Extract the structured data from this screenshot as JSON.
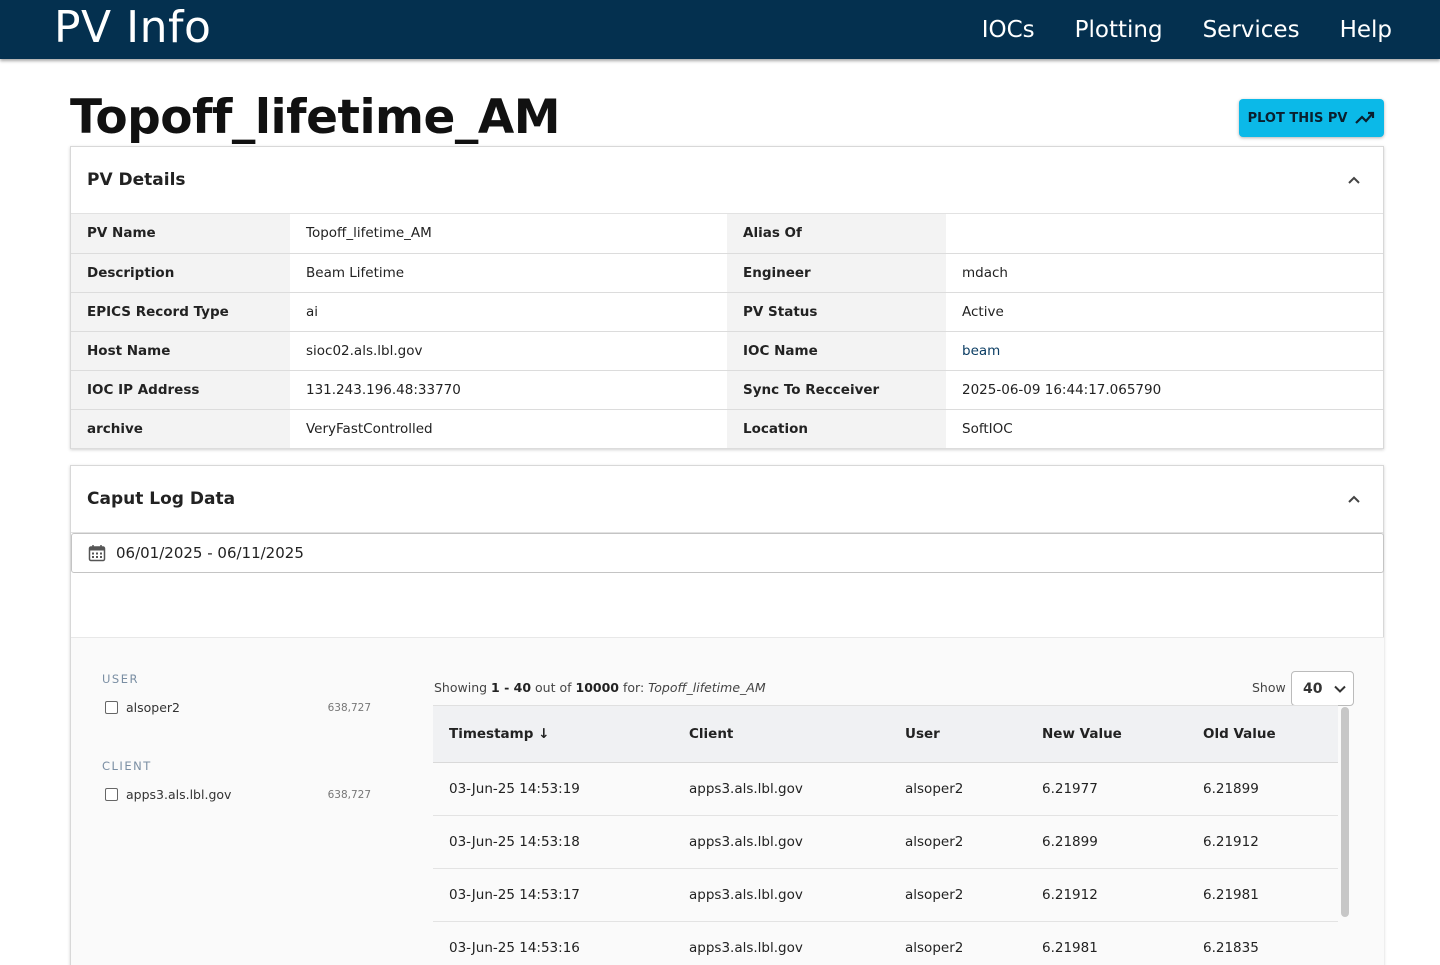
{
  "app": {
    "title": "PV Info",
    "nav": [
      "IOCs",
      "Plotting",
      "Services",
      "Help"
    ]
  },
  "page": {
    "title": "Topoff_lifetime_AM",
    "plot_button": "PLOT THIS PV",
    "plot_icon": "trending-up-icon"
  },
  "details": {
    "title": "PV Details",
    "rows": [
      {
        "l1": "PV Name",
        "v1": "Topoff_lifetime_AM",
        "l2": "Alias Of",
        "v2": ""
      },
      {
        "l1": "Description",
        "v1": "Beam Lifetime",
        "l2": "Engineer",
        "v2": "mdach"
      },
      {
        "l1": "EPICS Record Type",
        "v1": "ai",
        "l2": "PV Status",
        "v2": "Active"
      },
      {
        "l1": "Host Name",
        "v1": "sioc02.als.lbl.gov",
        "l2": "IOC Name",
        "v2": "beam"
      },
      {
        "l1": "IOC IP Address",
        "v1": "131.243.196.48:33770",
        "l2": "Sync To Recceiver",
        "v2": "2025-06-09 16:44:17.065790"
      },
      {
        "l1": "archive",
        "v1": "VeryFastControlled",
        "l2": "Location",
        "v2": "SoftIOC"
      }
    ]
  },
  "caput": {
    "title": "Caput Log Data",
    "date_range": "06/01/2025 - 06/11/2025",
    "facets": {
      "user_title": "USER",
      "user_item": "alsoper2",
      "user_count": "638,727",
      "client_title": "CLIENT",
      "client_item": "apps3.als.lbl.gov",
      "client_count": "638,727"
    },
    "showing": {
      "prefix": "Showing",
      "range": "1 - 40",
      "out_of": "out of",
      "total": "10000",
      "for": "for:",
      "pv": "Topoff_lifetime_AM"
    },
    "show_label": "Show",
    "show_value": "40",
    "columns": [
      "Timestamp ↓",
      "Client",
      "User",
      "New Value",
      "Old Value"
    ],
    "rows": [
      [
        "03-Jun-25 14:53:19",
        "apps3.als.lbl.gov",
        "alsoper2",
        "6.21977",
        "6.21899"
      ],
      [
        "03-Jun-25 14:53:18",
        "apps3.als.lbl.gov",
        "alsoper2",
        "6.21899",
        "6.21912"
      ],
      [
        "03-Jun-25 14:53:17",
        "apps3.als.lbl.gov",
        "alsoper2",
        "6.21912",
        "6.21981"
      ],
      [
        "03-Jun-25 14:53:16",
        "apps3.als.lbl.gov",
        "alsoper2",
        "6.21981",
        "6.21835"
      ]
    ]
  },
  "colors": {
    "topbar": "#04304f",
    "accent_button": "#0bb9e8",
    "link": "#0b3d63"
  }
}
